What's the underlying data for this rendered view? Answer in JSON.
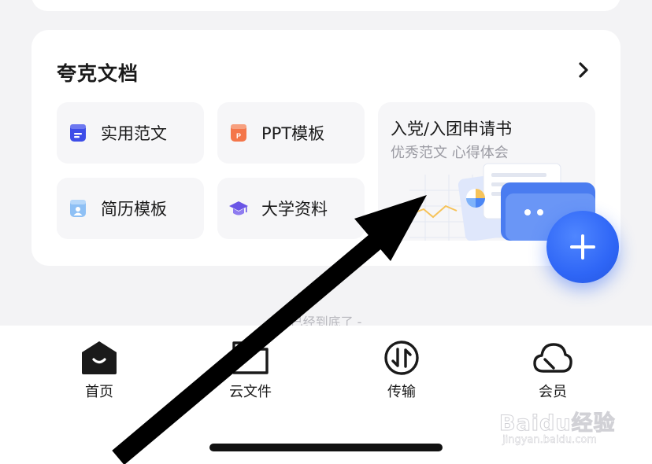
{
  "quark_docs": {
    "title": "夸克文档",
    "tiles": [
      {
        "label": "实用范文",
        "icon": "document-icon",
        "color": "#3d4de8"
      },
      {
        "label": "PPT模板",
        "icon": "ppt-icon",
        "color": "#f4764a"
      },
      {
        "label": "简历模板",
        "icon": "resume-icon",
        "color": "#5aa0f0"
      },
      {
        "label": "大学资料",
        "icon": "graduation-cap-icon",
        "color": "#6a55e6"
      }
    ],
    "feature": {
      "title": "入党/入团申请书",
      "subtitle": "优秀范文 心得体会"
    }
  },
  "end_note": "已经到底了 -",
  "tabs": [
    {
      "label": "首页",
      "icon": "home-icon"
    },
    {
      "label": "云文件",
      "icon": "folder-icon"
    },
    {
      "label": "传输",
      "icon": "transfer-icon"
    },
    {
      "label": "会员",
      "icon": "cloud-icon"
    }
  ],
  "watermark": {
    "brand": "Baidu经验",
    "url": "jingyan.baidu.com"
  },
  "colors": {
    "accent": "#2f66f6",
    "background": "#f3f3f5"
  }
}
